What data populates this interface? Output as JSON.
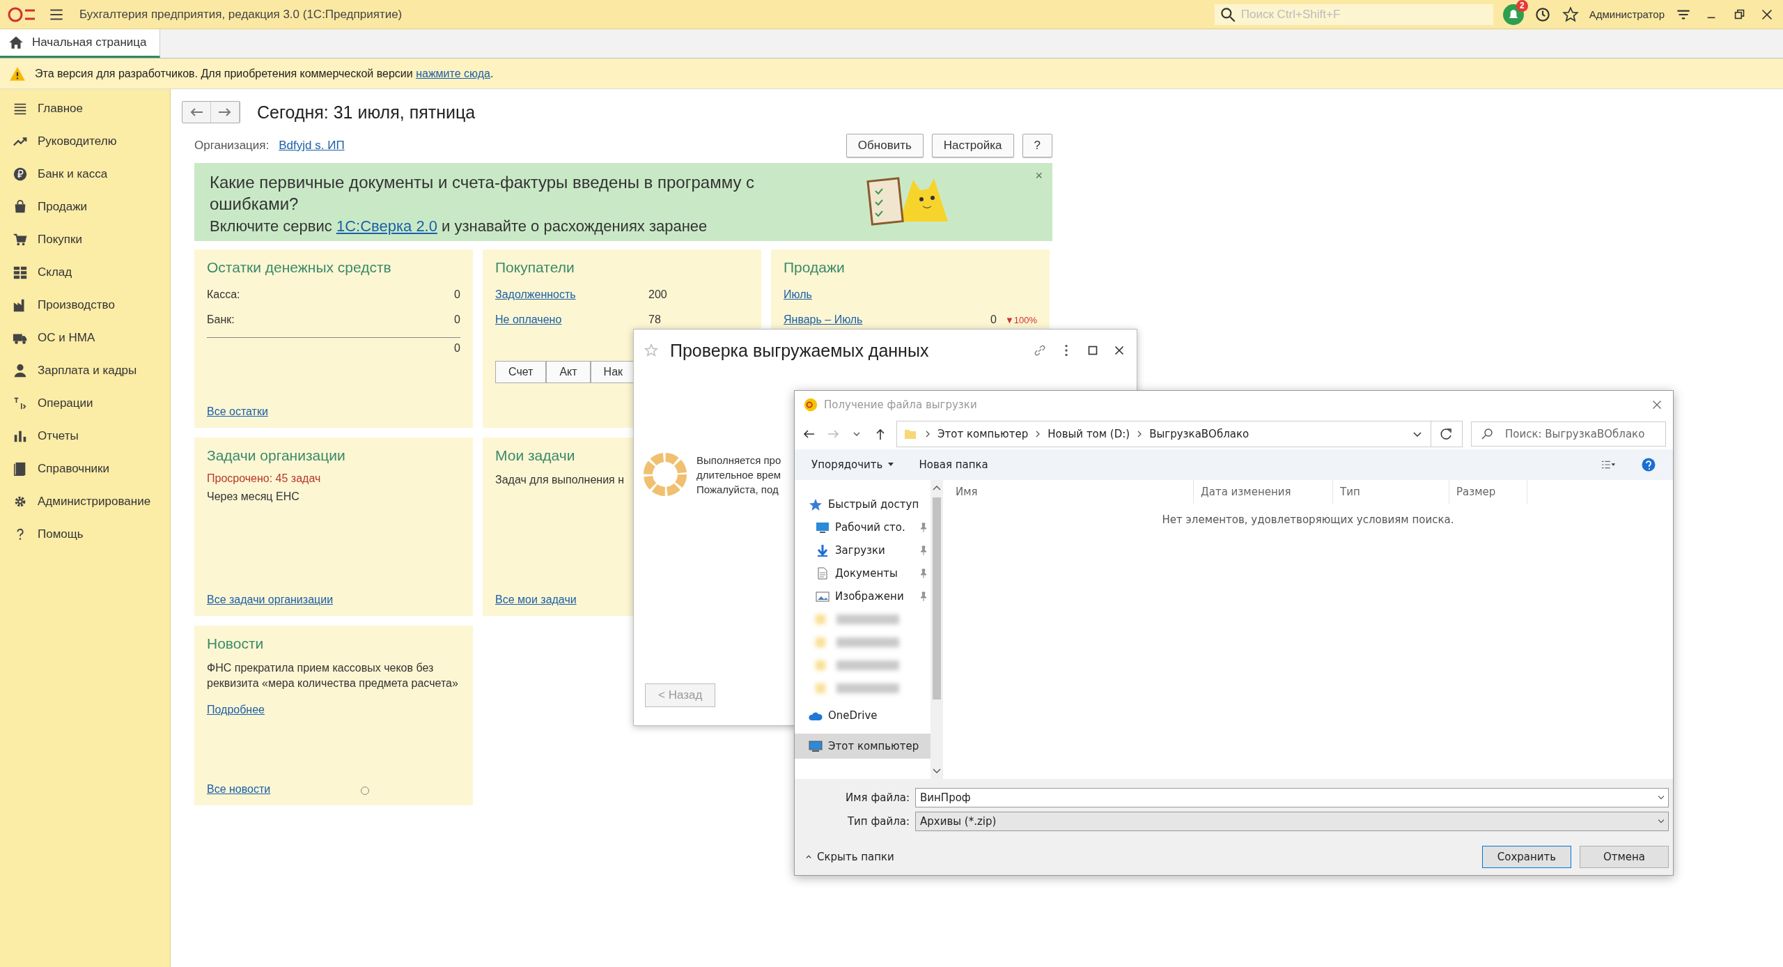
{
  "titlebar": {
    "title": "Бухгалтерия предприятия, редакция 3.0  (1С:Предприятие)",
    "search_placeholder": "Поиск Ctrl+Shift+F",
    "notifications": "2",
    "user": "Администратор"
  },
  "tabs": [
    {
      "label": "Начальная страница",
      "selected": true
    }
  ],
  "notice": {
    "text": "Эта версия для разработчиков. Для приобретения коммерческой версии",
    "link": "нажмите сюда",
    "tail": "."
  },
  "sidebar": {
    "items": [
      {
        "label": "Главное"
      },
      {
        "label": "Руководителю"
      },
      {
        "label": "Банк и касса"
      },
      {
        "label": "Продажи"
      },
      {
        "label": "Покупки"
      },
      {
        "label": "Склад"
      },
      {
        "label": "Производство"
      },
      {
        "label": "ОС и НМА"
      },
      {
        "label": "Зарплата и кадры"
      },
      {
        "label": "Операции"
      },
      {
        "label": "Отчеты"
      },
      {
        "label": "Справочники"
      },
      {
        "label": "Администрирование"
      },
      {
        "label": "Помощь"
      }
    ]
  },
  "header": {
    "title": "Сегодня: 31 июля, пятница",
    "org_label": "Организация:",
    "org": "Bdfyjd s. ИП",
    "buttons": [
      "Обновить",
      "Настройка",
      "?"
    ]
  },
  "banner": {
    "title": "Какие первичные документы и счета-фактуры введены в программу с ошибками?",
    "text_before": "Включите сервис",
    "link": "1С:Сверка 2.0",
    "text_after": "и узнавайте о расхождениях заранее",
    "close": "×"
  },
  "cash": {
    "title": "Остатки денежных средств",
    "rows": [
      {
        "label": "Касса:",
        "value": "0"
      },
      {
        "label": "Банк:",
        "value": "0"
      }
    ],
    "total": "0",
    "link": "Все остатки"
  },
  "buyers": {
    "title": "Покупатели",
    "rows": [
      {
        "label": "Задолженность",
        "value": "200"
      },
      {
        "label": "Не оплачено",
        "value": "78"
      }
    ],
    "buttons": [
      "Счет",
      "Акт",
      "Нак"
    ]
  },
  "sales": {
    "title": "Продажи",
    "month": "Июль",
    "period": "Январь – Июль",
    "value": "0",
    "change": "▼100%"
  },
  "org_tasks": {
    "title": "Задачи организации",
    "overdue": "Просрочено: 45 задач",
    "items": [
      "Через месяц ЕНС"
    ],
    "link": "Все задачи организации"
  },
  "my_tasks": {
    "title": "Мои задачи",
    "text": "Задач для выполнения н",
    "link": "Все мои задачи"
  },
  "news": {
    "title": "Новости",
    "text": "ФНС прекратила прием кассовых чеков без реквизита «мера количества предмета расчета»",
    "more": "Подробнее",
    "link": "Все новости"
  },
  "check_dialog": {
    "title": "Проверка выгружаемых данных",
    "lines": [
      "Выполняется про",
      "длительное врем",
      "Пожалуйста, под"
    ],
    "back": "< Назад"
  },
  "file_dialog": {
    "title": "Получение файла выгрузки",
    "path": [
      "Этот компьютер",
      "Новый том (D:)",
      "ВыгрузкаВОблако"
    ],
    "search_placeholder": "Поиск: ВыгрузкаВОблако",
    "toolbar": [
      "Упорядочить",
      "Новая папка"
    ],
    "nav": [
      {
        "kind": "group",
        "label": "Быстрый доступ",
        "pinned": false,
        "selected": false
      },
      {
        "kind": "item",
        "label": "Рабочий сто.",
        "pinned": true,
        "selected": false
      },
      {
        "kind": "item",
        "label": "Загрузки",
        "pinned": true,
        "selected": false
      },
      {
        "kind": "item",
        "label": "Документы",
        "pinned": true,
        "selected": false
      },
      {
        "kind": "item",
        "label": "Изображени",
        "pinned": true,
        "selected": false
      },
      {
        "kind": "blurred"
      },
      {
        "kind": "blurred"
      },
      {
        "kind": "blurred"
      },
      {
        "kind": "blurred"
      },
      {
        "kind": "group",
        "label": "OneDrive",
        "pinned": false,
        "selected": false
      },
      {
        "kind": "group",
        "label": "Этот компьютер",
        "pinned": false,
        "selected": true
      }
    ],
    "columns": [
      "Имя",
      "Дата изменения",
      "Тип",
      "Размер"
    ],
    "empty": "Нет элементов, удовлетворяющих условиям поиска.",
    "filename_label": "Имя файла:",
    "filename": "ВинПроф",
    "type_label": "Тип файла:",
    "type": "Архивы (*.zip)",
    "hide": "Скрыть папки",
    "buttons": [
      "Сохранить",
      "Отмена"
    ]
  }
}
